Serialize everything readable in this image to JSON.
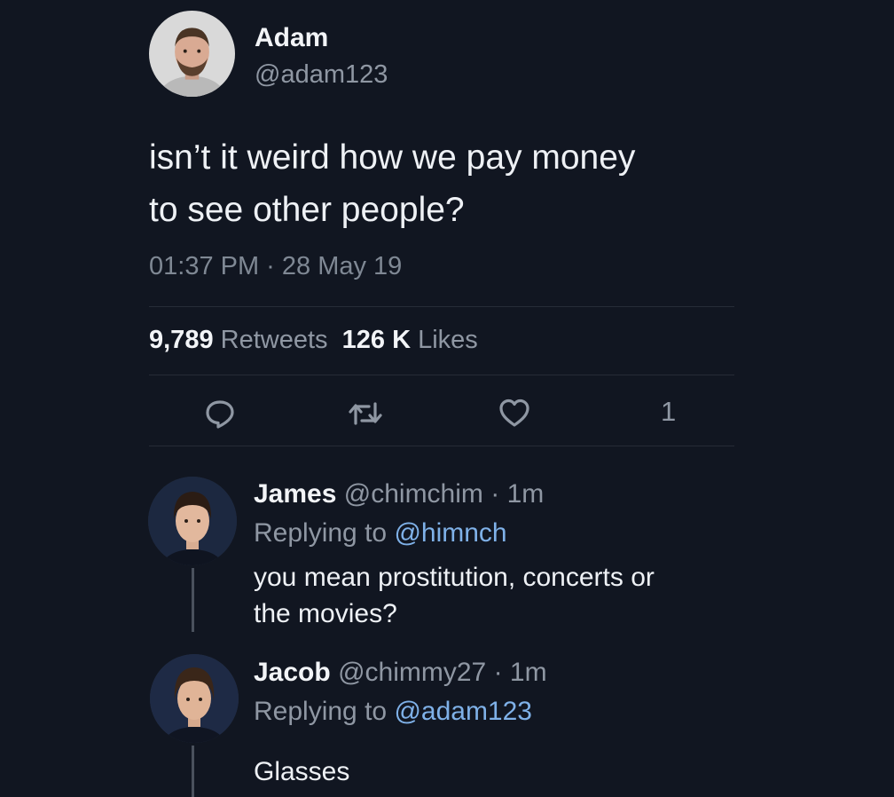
{
  "tweet": {
    "author_name": "Adam",
    "author_handle": "@adam123",
    "text_line1": "isn’t it weird how we pay money",
    "text_line2": "to see other people?",
    "timestamp": "01:37 PM · 28 May 19",
    "retweet_count": "9,789",
    "retweet_label": "Retweets",
    "like_count": "126 K",
    "like_label": "Likes",
    "share_count": "1",
    "icons": [
      "reply-icon",
      "retweet-icon",
      "like-icon"
    ]
  },
  "replies": [
    {
      "name": "James",
      "handle": "@chimchim",
      "time": "· 1m",
      "replying_prefix": "Replying to",
      "replying_to": "@himnch",
      "text_line1": "you mean prostitution, concerts or",
      "text_line2": "the movies?"
    },
    {
      "name": "Jacob",
      "handle": "@chimmy27",
      "time": "· 1m",
      "replying_prefix": "Replying to",
      "replying_to": "@adam123",
      "text_line1": "Glasses"
    }
  ],
  "colors": {
    "background": "#111621",
    "primary_text": "#eef1f5",
    "secondary_text": "#8f97a3",
    "mention": "#7fb1e8"
  }
}
